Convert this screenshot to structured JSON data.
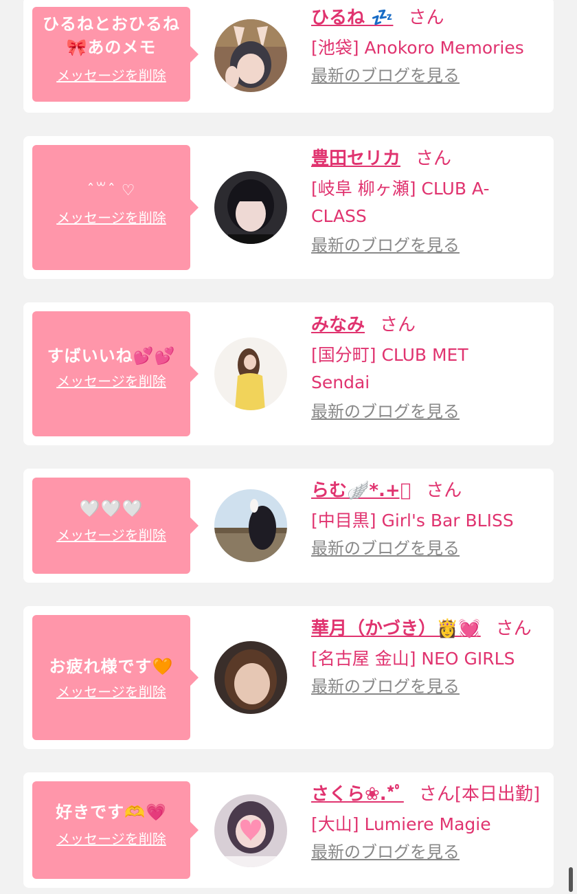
{
  "accent_color": "#e0336f",
  "bubble_color": "#ff96aa",
  "delete_label": "メッセージを削除",
  "blog_label": "最新のブログを見る",
  "san_label": "さん",
  "entries": [
    {
      "message_line1": "ひるねとおひるね",
      "message_line2": "🎀あのメモ",
      "name": "ひるね 💤",
      "san": "さん",
      "shop": "[池袋] Anokoro Memories",
      "avatar": "person-photo"
    },
    {
      "message_line1": "ˆ꒳ˆ ♡",
      "message_line2": "",
      "name": "豊田セリカ",
      "san": "さん",
      "shop": "[岐阜 柳ヶ瀬] CLUB A-CLASS",
      "avatar": "person-photo"
    },
    {
      "message_line1": "すばいいね💕💕",
      "message_line2": "",
      "name": "みなみ",
      "san": "さん",
      "shop": "[国分町] CLUB MET Sendai",
      "avatar": "person-photo"
    },
    {
      "message_line1": "🤍🤍🤍",
      "message_line2": "",
      "name": "らむ🪽*.+ﾟ",
      "san": "さん",
      "shop": "[中目黒] Girl's Bar BLISS",
      "avatar": "person-photo"
    },
    {
      "message_line1": "お疲れ様です🧡",
      "message_line2": "",
      "name": "華月（かづき）👸💓",
      "san": "さん",
      "shop": "[名古屋 金山] NEO GIRLS",
      "avatar": "person-photo"
    },
    {
      "message_line1": "好きです🫶💗",
      "message_line2": "",
      "name": "さくら❀.*ﾟ",
      "san": "さん[本日出勤]",
      "shop": "[大山] Lumiere Magie",
      "avatar": "person-photo"
    }
  ]
}
